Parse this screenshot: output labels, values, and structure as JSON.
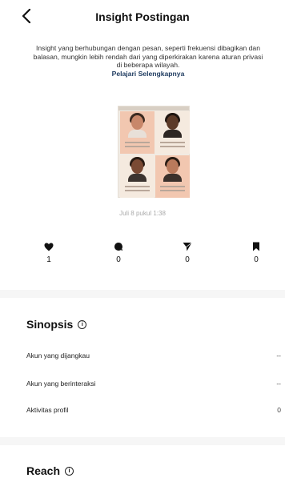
{
  "header": {
    "title": "Insight Postingan",
    "back_icon": "chevron-left-icon"
  },
  "notice": {
    "text": "Insight yang berhubungan dengan pesan, seperti frekuensi dibagikan dan balasan, mungkin lebih rendah dari yang diperkirakan karena aturan privasi di beberapa wilayah.",
    "link": "Pelajari Selengkapnya"
  },
  "post": {
    "date": "Juli 8 pukul 1:38"
  },
  "stats": [
    {
      "icon": "heart-icon",
      "value": "1"
    },
    {
      "icon": "comment-icon",
      "value": "0"
    },
    {
      "icon": "share-icon",
      "value": "0"
    },
    {
      "icon": "bookmark-icon",
      "value": "0"
    }
  ],
  "sinopsis": {
    "title": "Sinopsis",
    "rows": [
      {
        "label": "Akun yang dijangkau",
        "value": "--"
      },
      {
        "label": "Akun yang berinteraksi",
        "value": "--"
      },
      {
        "label": "Aktivitas profil",
        "value": "0"
      }
    ]
  },
  "reach": {
    "title": "Reach"
  },
  "colors": {
    "accent_link": "#1d3a5f",
    "divider": "#f6f6f6"
  }
}
